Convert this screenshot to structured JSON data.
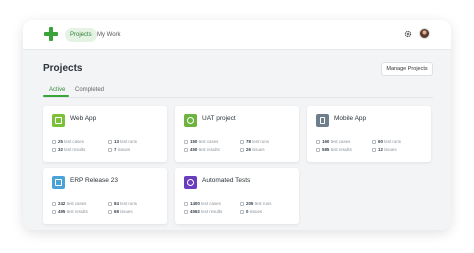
{
  "nav": {
    "projects": "Projects",
    "my_work": "My Work"
  },
  "page": {
    "title": "Projects",
    "manage_button": "Manage Projects"
  },
  "tabs": {
    "active": "Active",
    "completed": "Completed"
  },
  "colors": {
    "brand": "#3aa33a"
  },
  "cards": [
    {
      "title": "Web App",
      "icon": "app-window-icon",
      "color": "#7bbf3a",
      "test_cases": "25",
      "test_cases_label": "test cases",
      "test_runs": "13",
      "test_runs_label": "test runs",
      "test_results": "32",
      "test_results_label": "test results",
      "issues": "7",
      "issues_label": "issues"
    },
    {
      "title": "UAT project",
      "icon": "users-icon",
      "color": "#6db33f",
      "test_cases": "150",
      "test_cases_label": "test cases",
      "test_runs": "78",
      "test_runs_label": "test runs",
      "test_results": "450",
      "test_results_label": "test results",
      "issues": "26",
      "issues_label": "issues"
    },
    {
      "title": "Mobile App",
      "icon": "mobile-icon",
      "color": "#6f7e8c",
      "test_cases": "160",
      "test_cases_label": "test cases",
      "test_runs": "60",
      "test_runs_label": "test runs",
      "test_results": "585",
      "test_results_label": "test results",
      "issues": "12",
      "issues_label": "issues"
    },
    {
      "title": "ERP Release 23",
      "icon": "spreadsheet-icon",
      "color": "#4aa3d8",
      "test_cases": "242",
      "test_cases_label": "test cases",
      "test_runs": "84",
      "test_runs_label": "test runs",
      "test_results": "495",
      "test_results_label": "test results",
      "issues": "68",
      "issues_label": "issues"
    },
    {
      "title": "Automated Tests",
      "icon": "automation-icon",
      "color": "#6a3dbf",
      "test_cases": "1400",
      "test_cases_label": "test cases",
      "test_runs": "205",
      "test_runs_label": "test runs",
      "test_results": "4562",
      "test_results_label": "test results",
      "issues": "0",
      "issues_label": "issues"
    }
  ]
}
